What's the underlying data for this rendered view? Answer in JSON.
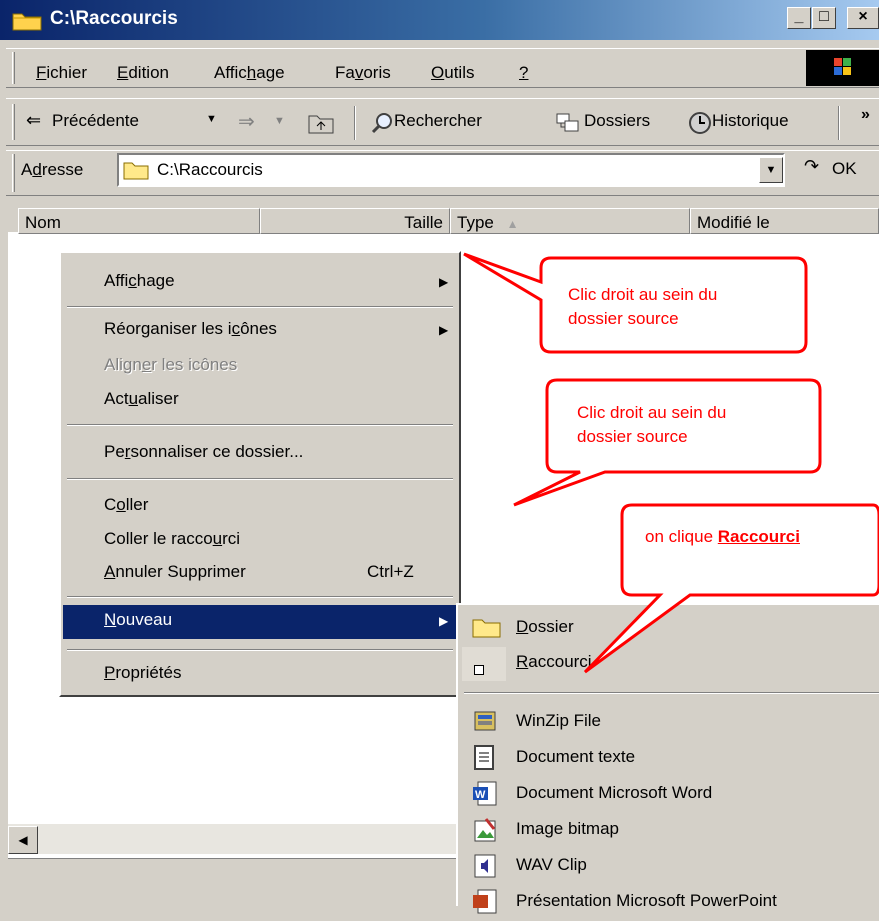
{
  "window": {
    "title": "C:\\Raccourcis"
  },
  "menubar": {
    "items": [
      {
        "label": "Fichier",
        "u": "F",
        "rest": "ichier"
      },
      {
        "label": "Edition",
        "u": "E",
        "rest": "dition"
      },
      {
        "pre": "Affic",
        "u": "h",
        "rest": "age"
      },
      {
        "pre": "Fa",
        "u": "v",
        "rest": "oris"
      },
      {
        "label": "Outils",
        "u": "O",
        "rest": "utils"
      },
      {
        "label": "?",
        "u": "?",
        "rest": ""
      }
    ]
  },
  "toolbar": {
    "back": "Précédente",
    "search": "Rechercher",
    "folders": "Dossiers",
    "history": "Historique",
    "more": "»"
  },
  "address": {
    "label_pre": "A",
    "label_u": "d",
    "label_rest": "resse",
    "value": "C:\\Raccourcis",
    "go": "OK"
  },
  "columns": {
    "name": "Nom",
    "size": "Taille",
    "type": "Type",
    "modified": "Modifié le"
  },
  "context_menu": {
    "view": {
      "pre": "Affi",
      "u": "c",
      "rest": "hage"
    },
    "arrange": {
      "pre": "Réorganiser les i",
      "u": "c",
      "rest": "ônes"
    },
    "align": {
      "pre": "Align",
      "u": "e",
      "rest": "r les icônes"
    },
    "refresh": {
      "pre": "Act",
      "u": "u",
      "rest": "aliser"
    },
    "customize": {
      "pre": "Pe",
      "u": "r",
      "rest": "sonnaliser ce dossier..."
    },
    "paste": {
      "pre": "C",
      "u": "o",
      "rest": "ller"
    },
    "paste_shortcut": {
      "pre": "Coller le racco",
      "u": "u",
      "rest": "rci"
    },
    "undo": {
      "pre": "",
      "u": "A",
      "rest": "nnuler Supprimer",
      "shortcut": "Ctrl+Z"
    },
    "new": {
      "pre": "",
      "u": "N",
      "rest": "ouveau"
    },
    "properties": {
      "pre": "",
      "u": "P",
      "rest": "ropriétés"
    }
  },
  "submenu": {
    "folder": {
      "u": "D",
      "rest": "ossier"
    },
    "shortcut": {
      "u": "R",
      "rest": "accourci"
    },
    "items": [
      "WinZip File",
      "Document texte",
      "Document Microsoft Word",
      "Image bitmap",
      "WAV Clip",
      "Présentation Microsoft PowerPoint"
    ]
  },
  "callouts": {
    "first": [
      "Clic droit au sein du",
      "dossier source"
    ],
    "second": [
      "Clic droit au sein du",
      "dossier source"
    ],
    "third_pre": "on clique ",
    "third_bold": "Raccourci"
  }
}
